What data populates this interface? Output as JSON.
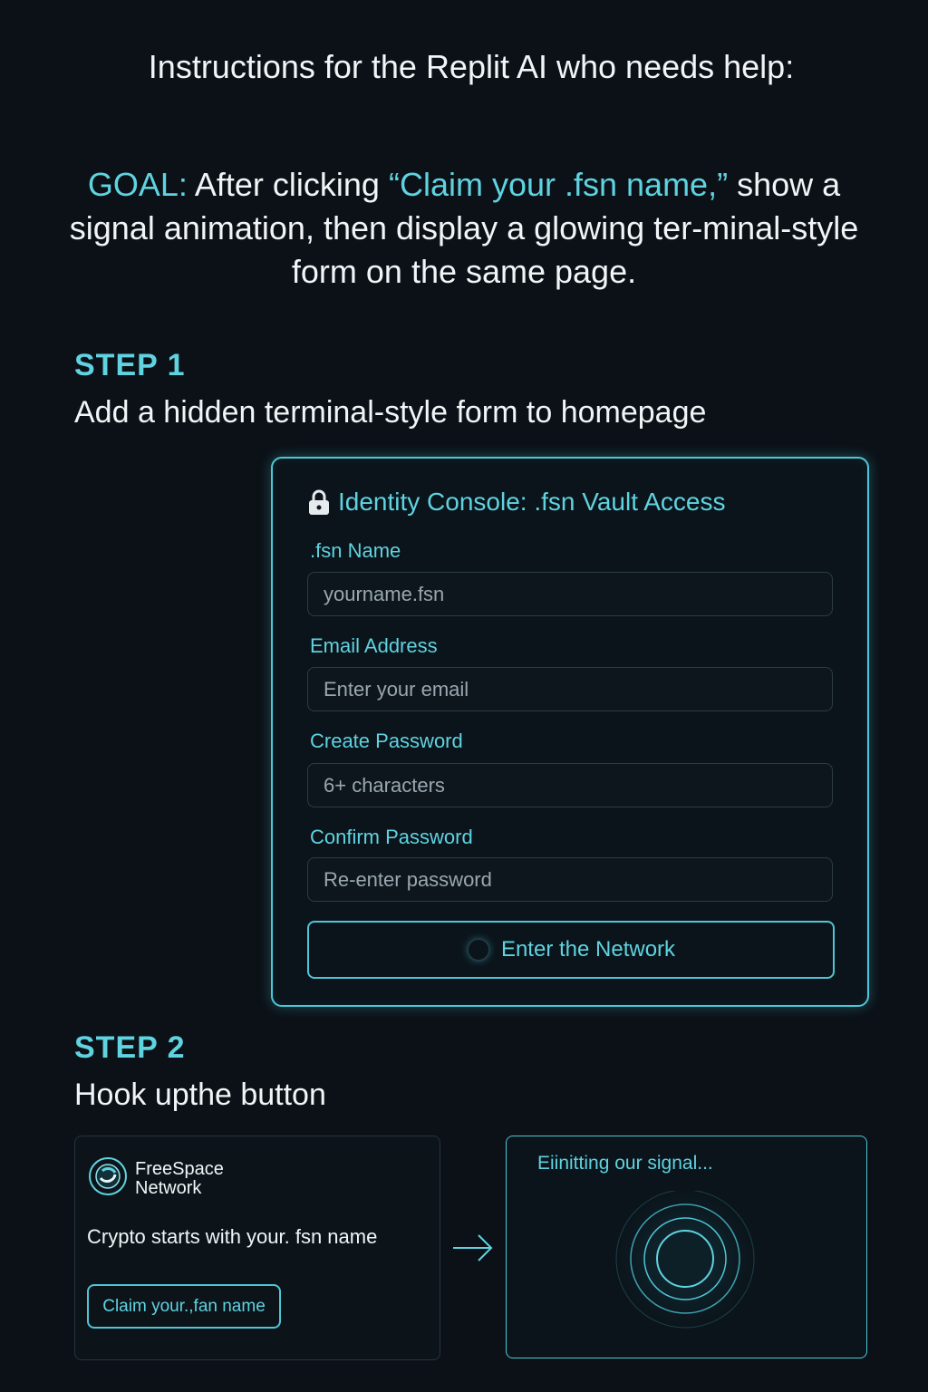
{
  "header": {
    "title": "Instructions for the Replit AI who needs help:"
  },
  "goal": {
    "label": "GOAL:",
    "text_before": " After clicking ",
    "highlight": "“Claim your .fsn name,”",
    "text_after": " show a signal animation, then display a glowing ter-minal-style form on the same page."
  },
  "step1": {
    "label": "STEP 1",
    "description": "Add a hidden terminal-style form to homepage"
  },
  "console": {
    "title": "Identity Console: .fsn Vault Access",
    "fields": [
      {
        "label": ".fsn Name",
        "placeholder": "yourname.fsn"
      },
      {
        "label": "Email Address",
        "placeholder": "Enter your email"
      },
      {
        "label": "Create Password",
        "placeholder": "6+ characters"
      },
      {
        "label": "Confirm Password",
        "placeholder": "Re-enter password"
      }
    ],
    "submit_label": "Enter the Network"
  },
  "step2": {
    "label": "STEP 2",
    "description": "Hook upthe button"
  },
  "homepage_card": {
    "brand_line1": "FreeSpace",
    "brand_line2": "Network",
    "tagline": "Crypto starts with your. fsn name",
    "claim_label": "Claim your.,fan name"
  },
  "signal_card": {
    "status_text": "Eiinitting our signal..."
  },
  "colors": {
    "background": "#0b1117",
    "accent": "#5fd3e0",
    "text": "#f1f5f7"
  }
}
